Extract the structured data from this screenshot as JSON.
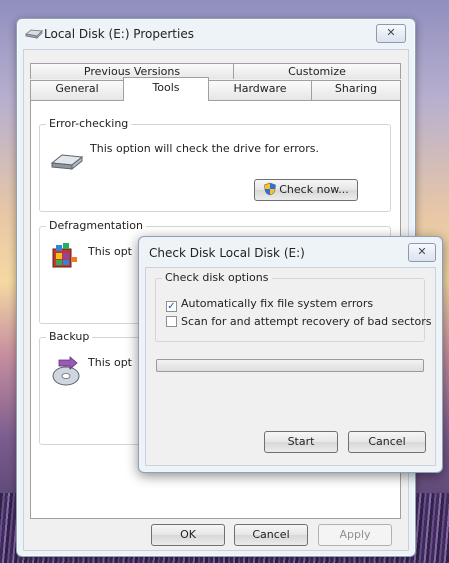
{
  "properties_window": {
    "title": "Local Disk (E:) Properties",
    "close_glyph": "✕",
    "tabs_back": [
      {
        "label": "Previous Versions"
      },
      {
        "label": "Customize"
      }
    ],
    "tabs_front": [
      {
        "label": "General"
      },
      {
        "label": "Tools",
        "active": true
      },
      {
        "label": "Hardware"
      },
      {
        "label": "Sharing"
      }
    ],
    "error_checking": {
      "label": "Error-checking",
      "text": "This option will check the drive for errors.",
      "button": "Check now..."
    },
    "defragmentation": {
      "label": "Defragmentation",
      "text": "This opt"
    },
    "backup": {
      "label": "Backup",
      "text": "This opt"
    },
    "buttons": {
      "ok": "OK",
      "cancel": "Cancel",
      "apply": "Apply"
    }
  },
  "check_disk_dialog": {
    "title": "Check Disk Local Disk (E:)",
    "close_glyph": "✕",
    "options_label": "Check disk options",
    "options": [
      {
        "label": "Automatically fix file system errors",
        "checked": true
      },
      {
        "label": "Scan for and attempt recovery of bad sectors",
        "checked": false
      }
    ],
    "progress": 0,
    "buttons": {
      "start": "Start",
      "cancel": "Cancel"
    }
  },
  "colors": {
    "accent": "#3c7fb1",
    "window_frame": "#eef3f8"
  }
}
